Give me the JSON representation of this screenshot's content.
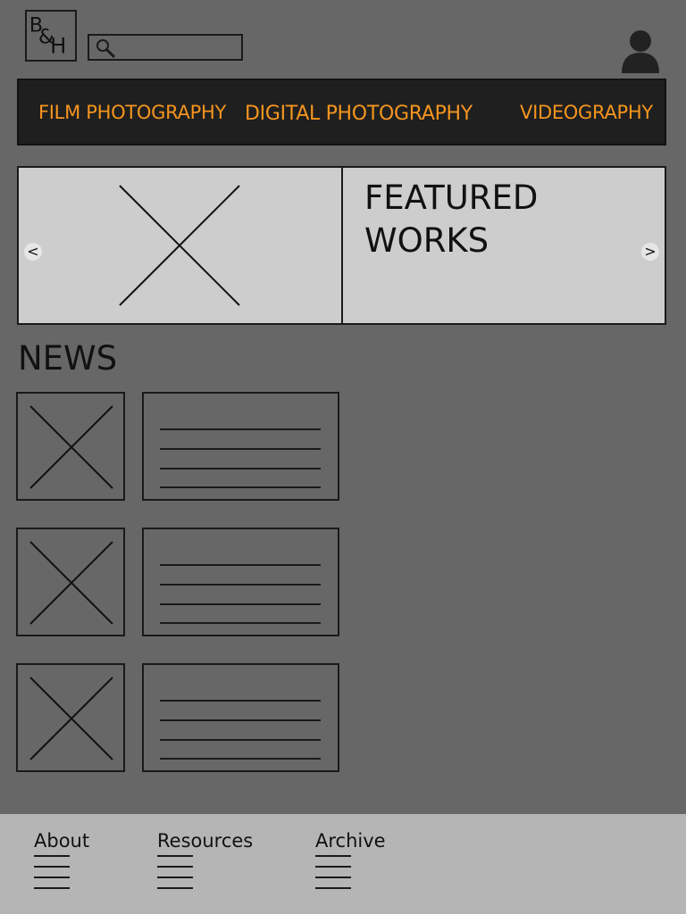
{
  "header": {
    "logo_text": "B&H",
    "search_placeholder": ""
  },
  "nav": {
    "items": [
      {
        "label": "FILM PHOTOGRAPHY"
      },
      {
        "label": "DIGITAL PHOTOGRAPHY"
      },
      {
        "label": "VIDEOGRAPHY"
      }
    ],
    "accent_color": "#f5951f"
  },
  "featured": {
    "title_line1": "FEATURED",
    "title_line2": "WORKS",
    "prev_glyph": "<",
    "next_glyph": ">"
  },
  "news": {
    "heading": "NEWS",
    "items": [
      {
        "image": "image-placeholder",
        "text": "text-placeholder"
      },
      {
        "image": "image-placeholder",
        "text": "text-placeholder"
      },
      {
        "image": "image-placeholder",
        "text": "text-placeholder"
      }
    ]
  },
  "footer": {
    "links": [
      {
        "label": "About"
      },
      {
        "label": "Resources"
      },
      {
        "label": "Archive"
      }
    ]
  }
}
